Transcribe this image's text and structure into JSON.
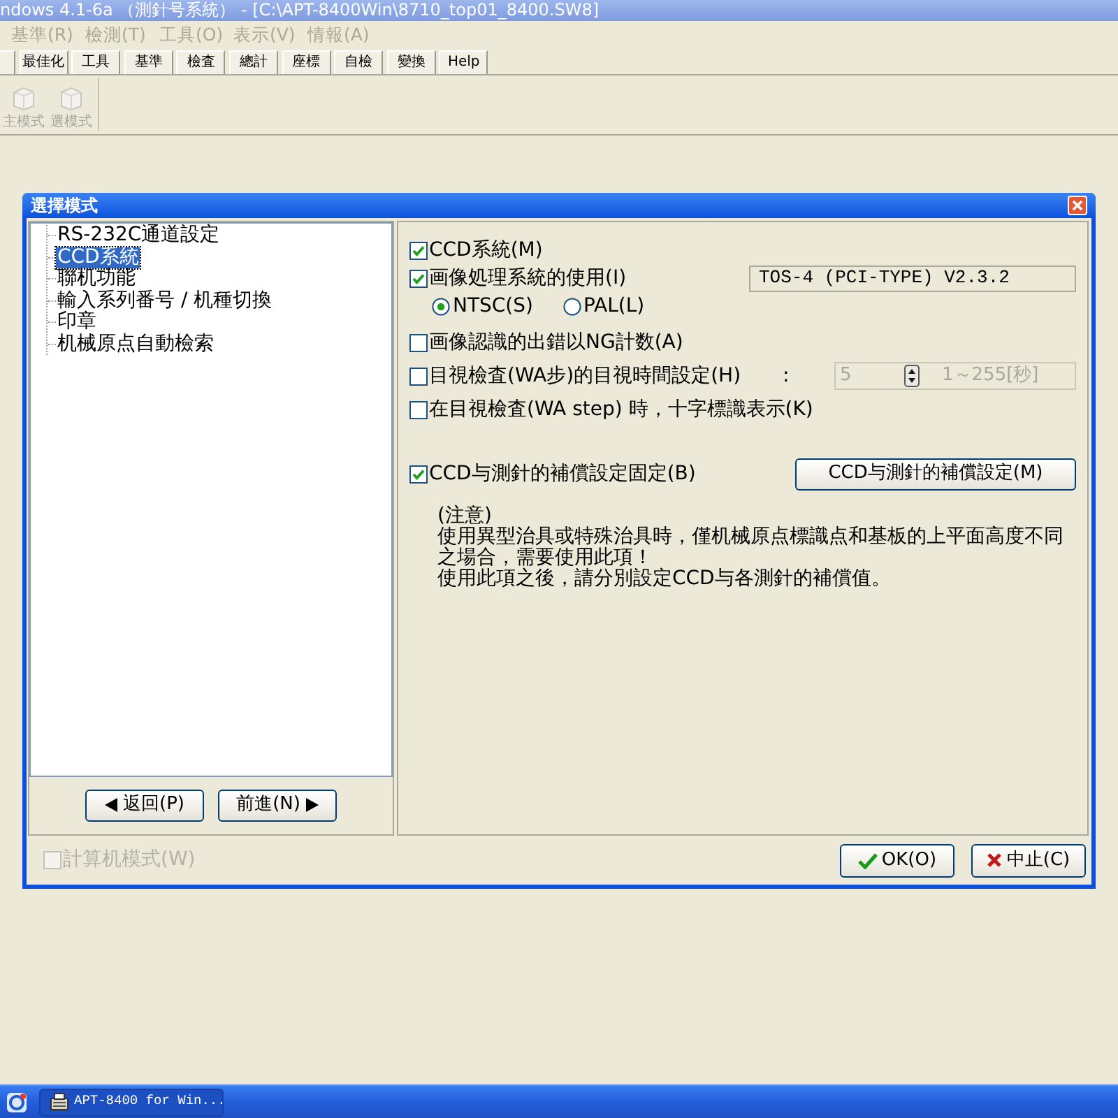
{
  "app_window": {
    "title": "ndows 4.1-6a （測針号系統） - [C:\\APT-8400Win\\8710_top01_8400.SW8]"
  },
  "menu_bar": [
    {
      "label": "基準(R)",
      "disabled": true
    },
    {
      "label": "檢測(T)",
      "disabled": true
    },
    {
      "label": "工具(O)",
      "disabled": true
    },
    {
      "label": "表示(V)",
      "disabled": true
    },
    {
      "label": "情報(A)",
      "disabled": true
    }
  ],
  "toolbar_tabs": [
    "最佳化",
    "工具",
    "基準",
    "檢査",
    "總計",
    "座標",
    "自檢",
    "變換",
    "Help"
  ],
  "toolbar_buttons": [
    {
      "label": "主模式",
      "disabled": true
    },
    {
      "label": "選模式",
      "disabled": true
    }
  ],
  "dialog": {
    "title": "選擇模式",
    "tree": [
      {
        "label": "RS-232C通道設定",
        "selected": false
      },
      {
        "label": "CCD系統",
        "selected": true
      },
      {
        "label": "聯机功能",
        "selected": false
      },
      {
        "label": "輸入系列番号 / 机種切換",
        "selected": false
      },
      {
        "label": "印章",
        "selected": false
      },
      {
        "label": "机械原点自動檢索",
        "selected": false
      }
    ],
    "nav_buttons": [
      {
        "label": "返回(P)",
        "kind": "back"
      },
      {
        "label": "前進(N)",
        "kind": "forward"
      }
    ],
    "option_groups": [
      [
        {
          "kind": "checkbox",
          "label": "CCD系統(M)",
          "checked": true
        },
        {
          "kind": "checkbox",
          "label": "画像処理系統的使用(I)",
          "checked": true,
          "info": "TOS-4 (PCI-TYPE) V2.3.2"
        },
        {
          "kind": "radio_group",
          "items": [
            {
              "label": "NTSC(S)",
              "selected": true
            },
            {
              "label": "PAL(L)",
              "selected": false
            }
          ]
        }
      ],
      [
        {
          "kind": "checkbox",
          "label": "画像認識的出錯以NG計数(A)",
          "checked": false
        },
        {
          "kind": "checkbox",
          "label": "目視檢査(WA步)的目視時間設定(H)",
          "checked": false,
          "separator": ":",
          "spin_field": {
            "value": "5",
            "range": "1～255[秒]",
            "disabled": true
          }
        },
        {
          "kind": "checkbox",
          "label": "在目視檢査(WA step) 時，十字標識表示(K)",
          "checked": false
        }
      ],
      [
        {
          "kind": "checkbox",
          "label": "CCD与測針的補償設定固定(B)",
          "checked": true,
          "button": "CCD与測針的補償設定(M)"
        }
      ]
    ],
    "note": {
      "heading": "(注意)",
      "paragraphs": [
        "使用異型治具或特殊治具時，僅机械原点標識点和基板的上平面高度不同之場合，需要使用此項！",
        "使用此項之後，請分別設定CCD与各測針的補償值。"
      ]
    },
    "computer_mode": {
      "label": "計算机模式(W)",
      "checked": false,
      "disabled": true
    },
    "buttons": [
      {
        "label": "OK(O)",
        "kind": "ok"
      },
      {
        "label": "中止(C)",
        "kind": "cancel"
      }
    ]
  },
  "taskbar": {
    "tasks": [
      {
        "label": "APT-8400 for Win..."
      }
    ]
  }
}
